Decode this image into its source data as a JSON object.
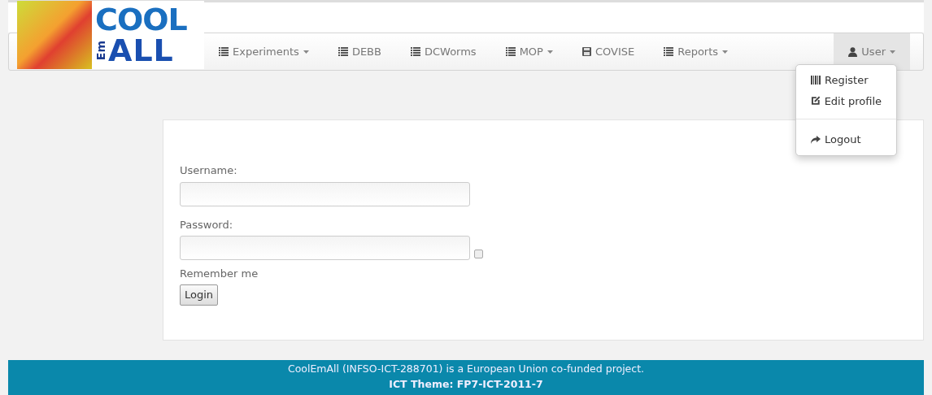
{
  "logo": {
    "top": "COOL",
    "side": "Em",
    "bottom": "ALL"
  },
  "nav": {
    "items": [
      {
        "label": "Experiments",
        "dropdown": true
      },
      {
        "label": "DEBB",
        "dropdown": false
      },
      {
        "label": "DCWorms",
        "dropdown": false
      },
      {
        "label": "MOP",
        "dropdown": true
      },
      {
        "label": "COVISE",
        "dropdown": false
      },
      {
        "label": "Reports",
        "dropdown": true
      }
    ],
    "user_menu": {
      "label": "User",
      "selected": true,
      "expanded": true,
      "items": [
        {
          "kind": "link",
          "label": "Register"
        },
        {
          "kind": "link",
          "label": "Edit profile"
        },
        {
          "kind": "divider"
        },
        {
          "kind": "link",
          "label": "Logout"
        }
      ]
    }
  },
  "login_form": {
    "username_label": "Username:",
    "password_label": "Password:",
    "remember": {
      "label": "Remember me",
      "checked": false
    },
    "submit": "Login"
  },
  "footer": {
    "line_1": "CoolEmAll (INFSO-ICT-288701) is a European Union co-funded project.",
    "line_2": "ICT Theme: FP7-ICT-2011-7"
  }
}
